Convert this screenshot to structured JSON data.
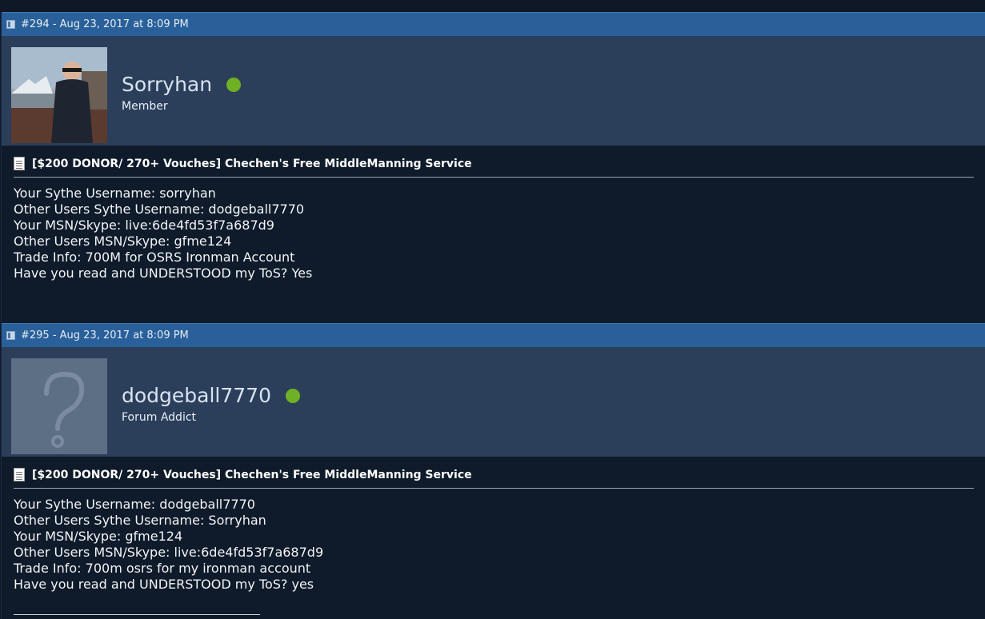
{
  "posts": [
    {
      "header": "#294 - Aug 23, 2017 at 8:09 PM",
      "username": "Sorryhan",
      "user_title": "Member",
      "thread_title": "[$200 DONOR/ 270+ Vouches] Chechen's Free MiddleManning Service",
      "lines": [
        "Your Sythe Username: sorryhan",
        "Other Users Sythe Username: dodgeball7770",
        "Your MSN/Skype: live:6de4fd53f7a687d9",
        "Other Users MSN/Skype: gfme124",
        "Trade Info: 700M for OSRS Ironman Account",
        "Have you read and UNDERSTOOD my ToS? Yes"
      ]
    },
    {
      "header": "#295 - Aug 23, 2017 at 8:09 PM",
      "username": "dodgeball7770",
      "user_title": "Forum Addict",
      "thread_title": "[$200 DONOR/ 270+ Vouches] Chechen's Free MiddleManning Service",
      "lines": [
        "Your Sythe Username: dodgeball7770",
        "Other Users Sythe Username: Sorryhan",
        "Your MSN/Skype: gfme124",
        "Other Users MSN/Skype: live:6de4fd53f7a687d9",
        "Trade Info: 700m osrs for my ironman account",
        "Have you read and UNDERSTOOD my ToS? yes"
      ]
    }
  ],
  "colors": {
    "header_bar": "#2a6099",
    "user_bar": "#2b3f5b",
    "page_bg": "#0f1b2a",
    "online": "#6fb124"
  }
}
